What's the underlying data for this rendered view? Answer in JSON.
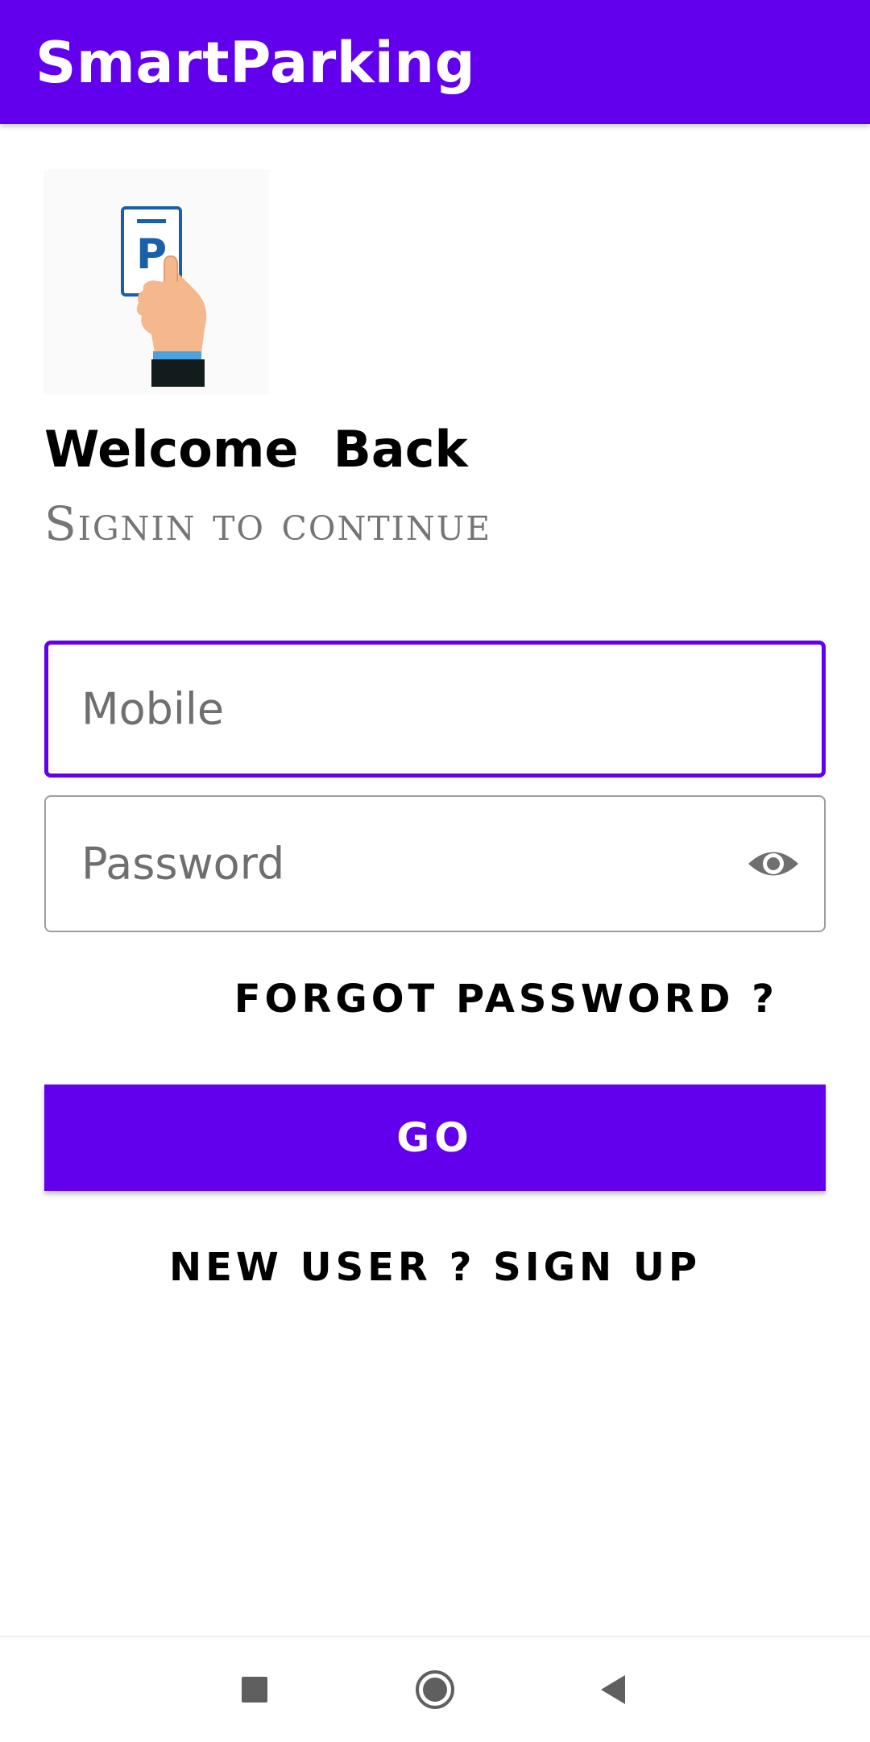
{
  "app_bar": {
    "title": "SmartParking",
    "color": "#6200EE"
  },
  "logo": {
    "icon": "parking-card-hand-icon",
    "sign_letter": "P"
  },
  "header": {
    "welcome": "Welcome  Back",
    "subtitle": "Signin to continue"
  },
  "form": {
    "mobile": {
      "placeholder": "Mobile",
      "value": ""
    },
    "password": {
      "placeholder": "Password",
      "value": "",
      "toggle_icon": "eye-icon"
    },
    "forgot_label": "FORGOT PASSWORD ?",
    "submit_label": "GO",
    "signup_label": "NEW USER ? SIGN UP"
  },
  "colors": {
    "accent": "#6200EE",
    "subtitle": "#757575",
    "placeholder": "#6f6f6f"
  },
  "system_nav": {
    "icons": [
      "recents-square-icon",
      "home-circle-icon",
      "back-triangle-icon"
    ]
  }
}
